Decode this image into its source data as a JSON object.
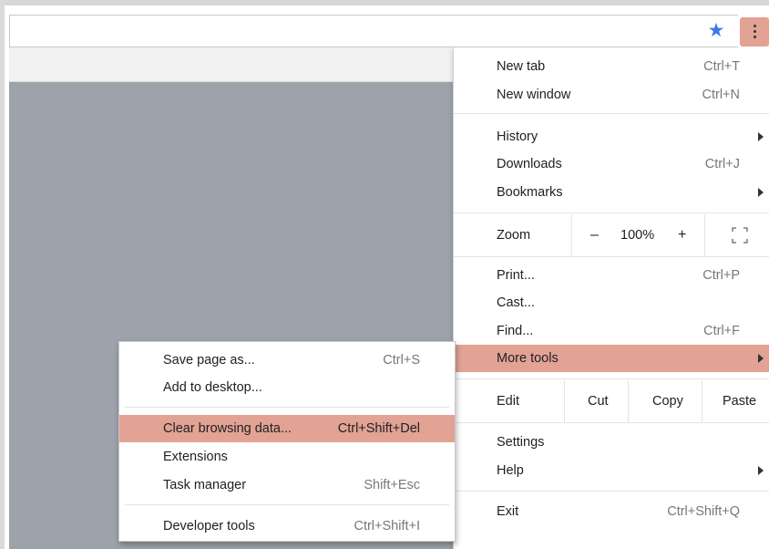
{
  "toolbar": {
    "bookmark_icon": "star-icon",
    "menu_icon": "kebab-icon"
  },
  "colors": {
    "highlight": "#e2a294",
    "star": "#3b78e7",
    "content_gray": "#9ea2aa"
  },
  "menu": {
    "new_tab": {
      "label": "New tab",
      "shortcut": "Ctrl+T"
    },
    "new_window": {
      "label": "New window",
      "shortcut": "Ctrl+N"
    },
    "history": {
      "label": "History"
    },
    "downloads": {
      "label": "Downloads",
      "shortcut": "Ctrl+J"
    },
    "bookmarks": {
      "label": "Bookmarks"
    },
    "zoom": {
      "label": "Zoom",
      "minus": "–",
      "level": "100%",
      "plus": "+"
    },
    "print": {
      "label": "Print...",
      "shortcut": "Ctrl+P"
    },
    "cast": {
      "label": "Cast..."
    },
    "find": {
      "label": "Find...",
      "shortcut": "Ctrl+F"
    },
    "more_tools": {
      "label": "More tools"
    },
    "edit": {
      "label": "Edit",
      "cut": "Cut",
      "copy": "Copy",
      "paste": "Paste"
    },
    "settings": {
      "label": "Settings"
    },
    "help": {
      "label": "Help"
    },
    "exit": {
      "label": "Exit",
      "shortcut": "Ctrl+Shift+Q"
    }
  },
  "submenu": {
    "save_page": {
      "label": "Save page as...",
      "shortcut": "Ctrl+S"
    },
    "add_desktop": {
      "label": "Add to desktop..."
    },
    "clear_data": {
      "label": "Clear browsing data...",
      "shortcut": "Ctrl+Shift+Del"
    },
    "extensions": {
      "label": "Extensions"
    },
    "task_manager": {
      "label": "Task manager",
      "shortcut": "Shift+Esc"
    },
    "dev_tools": {
      "label": "Developer tools",
      "shortcut": "Ctrl+Shift+I"
    }
  }
}
